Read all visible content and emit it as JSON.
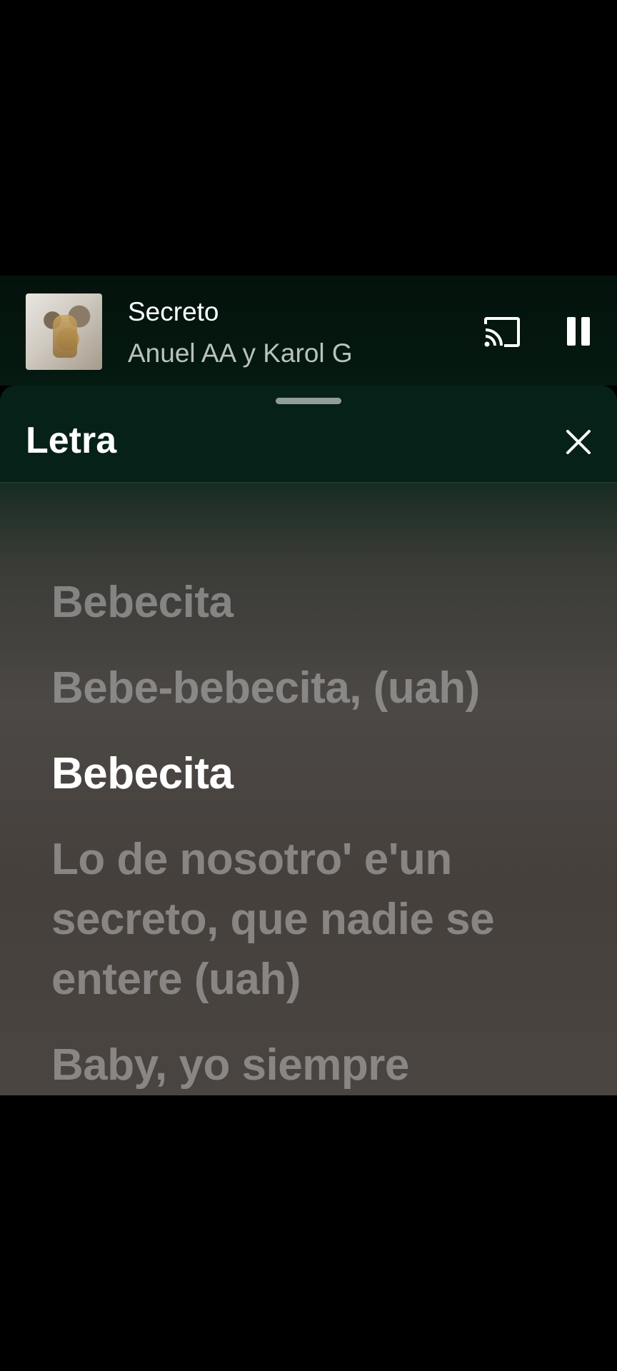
{
  "now_playing": {
    "title": "Secreto",
    "artist": "Anuel AA y Karol G",
    "album_art": "album-cover-image"
  },
  "controls": {
    "cast_icon": "cast-icon",
    "pause_icon": "pause-icon"
  },
  "lyrics_sheet": {
    "title": "Letra",
    "close_icon": "close-icon",
    "lines": [
      {
        "text": "Bebecita",
        "active": false
      },
      {
        "text": "Bebe-bebecita, (uah)",
        "active": false
      },
      {
        "text": "Bebecita",
        "active": true
      },
      {
        "text": "Lo de nosotro' e'un secreto, que nadie se entere (uah)",
        "active": false
      },
      {
        "text": "Baby, yo siempre",
        "active": false
      }
    ]
  },
  "colors": {
    "header_bg": "#062117",
    "active_lyric": "#ffffff",
    "inactive_lyric": "#bebebe"
  }
}
